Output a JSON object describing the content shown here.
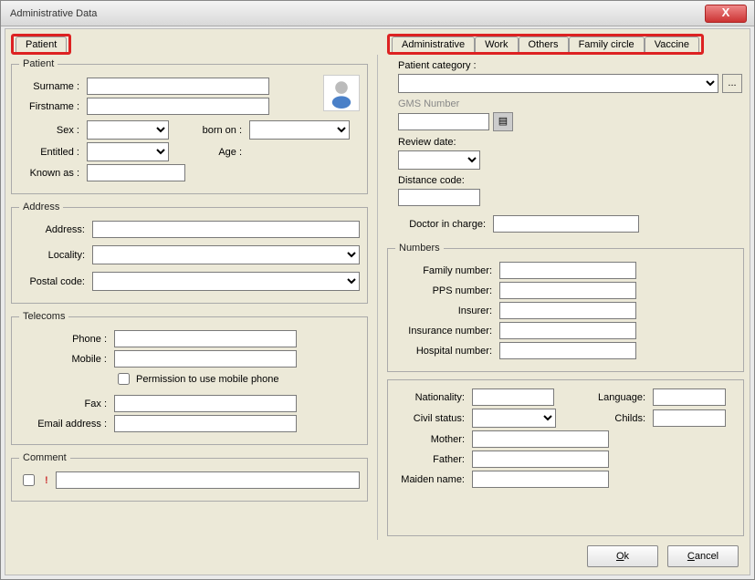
{
  "window": {
    "title": "Administrative Data"
  },
  "tabs_left": [
    "Patient"
  ],
  "tabs_right": [
    "Administrative",
    "Work",
    "Others",
    "Family circle",
    "Vaccine"
  ],
  "patient": {
    "legend": "Patient",
    "surname_label": "Surname :",
    "surname": "",
    "firstname_label": "Firstname :",
    "firstname": "",
    "sex_label": "Sex :",
    "born_label": "born on :",
    "entitled_label": "Entitled :",
    "age_label": "Age :",
    "knownas_label": "Known as :",
    "knownas": ""
  },
  "address": {
    "legend": "Address",
    "address_label": "Address:",
    "address": "",
    "locality_label": "Locality:",
    "postal_label": "Postal code:"
  },
  "telecoms": {
    "legend": "Telecoms",
    "phone_label": "Phone :",
    "phone": "",
    "mobile_label": "Mobile :",
    "mobile": "",
    "permission_label": "Permission to use mobile phone",
    "fax_label": "Fax :",
    "fax": "",
    "email_label": "Email address :",
    "email": ""
  },
  "comment": {
    "legend": "Comment",
    "text": ""
  },
  "admin": {
    "category_label": "Patient category :",
    "gms_label": "GMS Number",
    "gms": "",
    "review_label": "Review date:",
    "distance_label": "Distance code:",
    "distance": "",
    "doctor_label": "Doctor in charge:",
    "doctor": ""
  },
  "numbers": {
    "legend": "Numbers",
    "family_label": "Family number:",
    "family": "",
    "pps_label": "PPS number:",
    "pps": "",
    "insurer_label": "Insurer:",
    "insurer": "",
    "insurance_label": "Insurance number:",
    "insurance": "",
    "hospital_label": "Hospital number:",
    "hospital": ""
  },
  "personal": {
    "nationality_label": "Nationality:",
    "nationality": "",
    "language_label": "Language:",
    "language": "",
    "civil_label": "Civil status:",
    "childs_label": "Childs:",
    "childs": "",
    "mother_label": "Mother:",
    "mother": "",
    "father_label": "Father:",
    "father": "",
    "maiden_label": "Maiden name:",
    "maiden": ""
  },
  "buttons": {
    "ok": "k",
    "cancel": "ancel"
  }
}
